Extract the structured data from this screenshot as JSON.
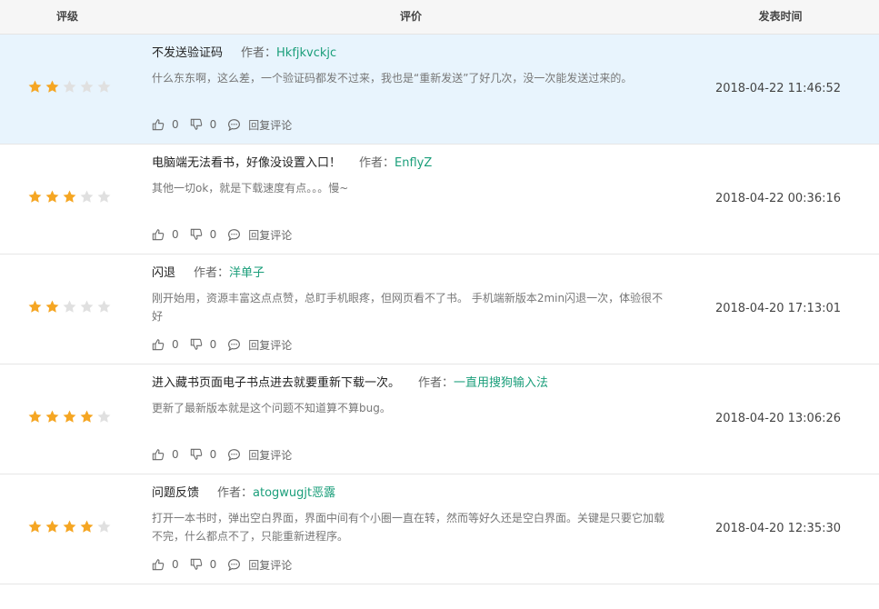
{
  "header": {
    "rating": "评级",
    "review": "评价",
    "time": "发表时间"
  },
  "labels": {
    "author_prefix": "作者：",
    "reply": "回复评论"
  },
  "colors": {
    "star_filled": "#f5a623",
    "star_empty": "#e0e0e0",
    "author": "#1a9e7a",
    "highlight_row": "#e8f4fd"
  },
  "rows": [
    {
      "rating": 2,
      "title": "不发送验证码",
      "author": "Hkfjkvckjc",
      "body": "什么东东啊，这么差，一个验证码都发不过来，我也是“重新发送”了好几次，没一次能发送过来的。",
      "likes": "0",
      "dislikes": "0",
      "time": "2018-04-22 11:46:52",
      "highlighted": true
    },
    {
      "rating": 3,
      "title": "电脑端无法看书，好像没设置入口！",
      "author": "EnflyZ",
      "body": "其他一切ok，就是下载速度有点。。。慢~",
      "likes": "0",
      "dislikes": "0",
      "time": "2018-04-22 00:36:16",
      "highlighted": false
    },
    {
      "rating": 2,
      "title": "闪退",
      "author": "洋单子",
      "body": "刚开始用，资源丰富这点点赞，总盯手机眼疼，但网页看不了书。 手机端新版本2min闪退一次，体验很不好",
      "likes": "0",
      "dislikes": "0",
      "time": "2018-04-20 17:13:01",
      "highlighted": false
    },
    {
      "rating": 4,
      "title": "进入藏书页面电子书点进去就要重新下载一次。",
      "author": "一直用搜狗输入法",
      "body": "更新了最新版本就是这个问题不知道算不算bug。",
      "likes": "0",
      "dislikes": "0",
      "time": "2018-04-20 13:06:26",
      "highlighted": false
    },
    {
      "rating": 4,
      "title": "问题反馈",
      "author": "atogwugjt恶露",
      "body": "打开一本书时，弹出空白界面，界面中间有个小圈一直在转，然而等好久还是空白界面。关键是只要它加载不完，什么都点不了，只能重新进程序。",
      "likes": "0",
      "dislikes": "0",
      "time": "2018-04-20 12:35:30",
      "highlighted": false
    }
  ]
}
